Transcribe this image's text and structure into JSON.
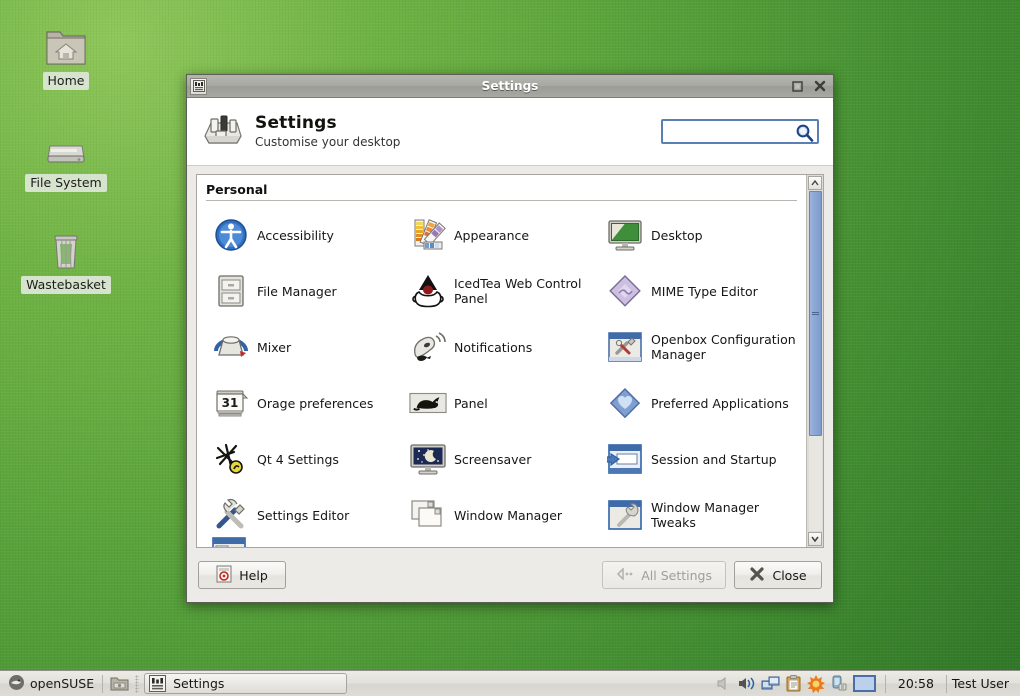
{
  "desktop": {
    "icons": [
      {
        "label": "Home",
        "icon": "home-folder-icon"
      },
      {
        "label": "File System",
        "icon": "harddisk-icon"
      },
      {
        "label": "Wastebasket",
        "icon": "trash-icon"
      }
    ],
    "background_color": "#57a13a"
  },
  "window": {
    "titlebar": {
      "title": "Settings",
      "app_icon": "settings-app-icon",
      "maximize_label": "Maximize",
      "close_label": "Close"
    },
    "header": {
      "icon": "settings-mixer-icon",
      "title": "Settings",
      "subtitle": "Customise your desktop"
    },
    "search": {
      "value": "",
      "placeholder": "",
      "icon": "search-icon"
    },
    "group": {
      "title": "Personal"
    },
    "items": [
      {
        "label": "Accessibility",
        "icon": "accessibility-icon"
      },
      {
        "label": "Appearance",
        "icon": "appearance-icon"
      },
      {
        "label": "Desktop",
        "icon": "desktop-icon"
      },
      {
        "label": "File Manager",
        "icon": "file-manager-icon"
      },
      {
        "label": "IcedTea Web Control Panel",
        "icon": "icedtea-java-icon"
      },
      {
        "label": "MIME Type Editor",
        "icon": "mime-type-icon"
      },
      {
        "label": "Mixer",
        "icon": "mixer-icon"
      },
      {
        "label": "Notifications",
        "icon": "notifications-icon"
      },
      {
        "label": "Openbox Configuration Manager",
        "icon": "openbox-config-icon"
      },
      {
        "label": "Orage preferences",
        "icon": "orage-calendar-icon"
      },
      {
        "label": "Panel",
        "icon": "panel-mouse-icon"
      },
      {
        "label": "Preferred Applications",
        "icon": "preferred-apps-icon"
      },
      {
        "label": "Qt 4 Settings",
        "icon": "qt4-settings-icon"
      },
      {
        "label": "Screensaver",
        "icon": "screensaver-icon"
      },
      {
        "label": "Session and Startup",
        "icon": "session-startup-icon"
      },
      {
        "label": "Settings Editor",
        "icon": "settings-editor-icon"
      },
      {
        "label": "Window Manager",
        "icon": "window-manager-icon"
      },
      {
        "label": "Window Manager Tweaks",
        "icon": "window-manager-tweaks-icon"
      }
    ],
    "scrollbar": {
      "thumb_percent": 72,
      "up_icon": "chevron-up-icon",
      "down_icon": "chevron-down-icon"
    },
    "footer": {
      "help_label": "Help",
      "help_icon": "help-icon",
      "all_settings_label": "All Settings",
      "all_settings_icon": "back-arrow-icon",
      "all_settings_disabled": true,
      "close_label": "Close",
      "close_icon": "close-x-icon"
    }
  },
  "taskbar": {
    "start_label": "openSUSE",
    "start_icon": "opensuse-logo-icon",
    "launcher_icon": "file-manager-launcher-icon",
    "tasks": [
      {
        "label": "Settings",
        "icon": "settings-app-icon"
      }
    ],
    "tray_icons": [
      "speaker-muted-icon",
      "volume-icon",
      "network-display-icon",
      "clipboard-icon",
      "updater-sun-icon",
      "power-battery-icon"
    ],
    "pager_name": "workspace-pager",
    "clock": "20:58",
    "user": "Test User"
  }
}
